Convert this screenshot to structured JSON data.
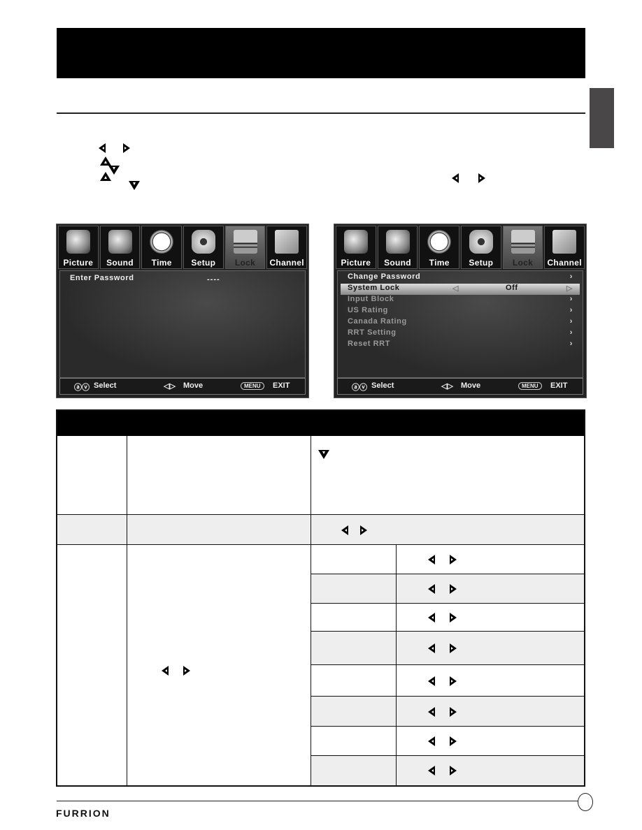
{
  "page": {
    "brand": "FURRION",
    "page_number": ""
  },
  "icons": {
    "nav_arrows": [
      "left-arrow-icon",
      "right-arrow-icon",
      "up-arrow-icon",
      "down-arrow-icon"
    ]
  },
  "screens": [
    {
      "tabs": [
        "Picture",
        "Sound",
        "Time",
        "Setup",
        "Lock",
        "Channel"
      ],
      "active_tab": "Lock",
      "prompt_label": "Enter Password",
      "password_value": "----",
      "footer": {
        "select": "Select",
        "move": "Move",
        "menu_key": "MENU",
        "exit": "EXIT"
      }
    },
    {
      "tabs": [
        "Picture",
        "Sound",
        "Time",
        "Setup",
        "Lock",
        "Channel"
      ],
      "active_tab": "Lock",
      "menu_items": [
        {
          "label": "Change Password",
          "value": "",
          "state": "normal"
        },
        {
          "label": "System Lock",
          "value": "Off",
          "state": "selected"
        },
        {
          "label": "Input Block",
          "value": "",
          "state": "disabled"
        },
        {
          "label": "US Rating",
          "value": "",
          "state": "disabled"
        },
        {
          "label": "Canada Rating",
          "value": "",
          "state": "disabled"
        },
        {
          "label": "RRT Setting",
          "value": "",
          "state": "disabled"
        },
        {
          "label": "Reset RRT",
          "value": "",
          "state": "disabled"
        }
      ],
      "footer": {
        "select": "Select",
        "move": "Move",
        "menu_key": "MENU",
        "exit": "EXIT"
      }
    }
  ]
}
